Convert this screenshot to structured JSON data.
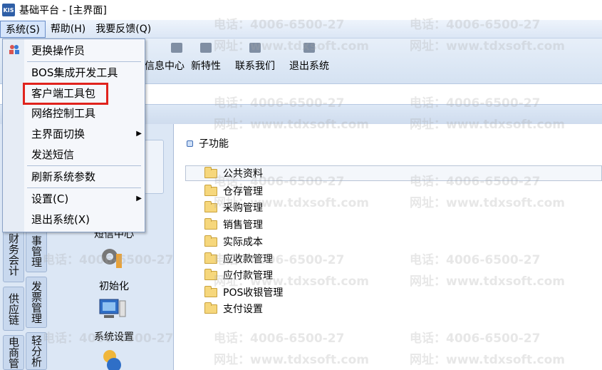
{
  "window": {
    "title": "基础平台 - [主界面]",
    "app_badge": "KIS"
  },
  "menubar": {
    "items": [
      {
        "label": "系统(S)"
      },
      {
        "label": "帮助(H)"
      },
      {
        "label": "我要反馈(Q)"
      }
    ]
  },
  "toolbar": {
    "items": [
      {
        "label": "信息中心",
        "icon": "mail-icon"
      },
      {
        "label": "新特性",
        "icon": "star-icon"
      },
      {
        "label": "联系我们",
        "icon": "chat-icon"
      },
      {
        "label": "退出系统",
        "icon": "exit-icon"
      }
    ]
  },
  "system_menu": {
    "items": [
      {
        "label": "更换操作员"
      },
      {
        "label": "BOS集成开发工具"
      },
      {
        "label": "客户端工具包"
      },
      {
        "label": "网络控制工具"
      },
      {
        "label": "主界面切换",
        "submenu": true
      },
      {
        "label": "发送短信"
      },
      {
        "label": "刷新系统参数"
      },
      {
        "label": "设置(C)",
        "submenu": true
      },
      {
        "label": "退出系统(X)"
      }
    ],
    "highlight_color": "#e0231d"
  },
  "left_tabs": [
    {
      "label": "财务会计"
    },
    {
      "label": "供应链"
    },
    {
      "label": "电商管"
    },
    {
      "label": "事管理"
    },
    {
      "label": "发票管理"
    },
    {
      "label": "轻分析"
    }
  ],
  "left_nav": {
    "items": [
      {
        "label": "短信中心"
      },
      {
        "label": "初始化"
      },
      {
        "label": "系统设置"
      }
    ]
  },
  "right_panel": {
    "section_title": "子功能",
    "root": "公共资料",
    "items": [
      {
        "label": "仓存管理"
      },
      {
        "label": "采购管理"
      },
      {
        "label": "销售管理"
      },
      {
        "label": "实际成本"
      },
      {
        "label": "应收款管理"
      },
      {
        "label": "应付款管理"
      },
      {
        "label": "POS收银管理"
      },
      {
        "label": "支付设置"
      }
    ]
  },
  "watermark": {
    "phone": "电话：4006-6500-27",
    "site": "网址：www.tdxsoft.com"
  }
}
